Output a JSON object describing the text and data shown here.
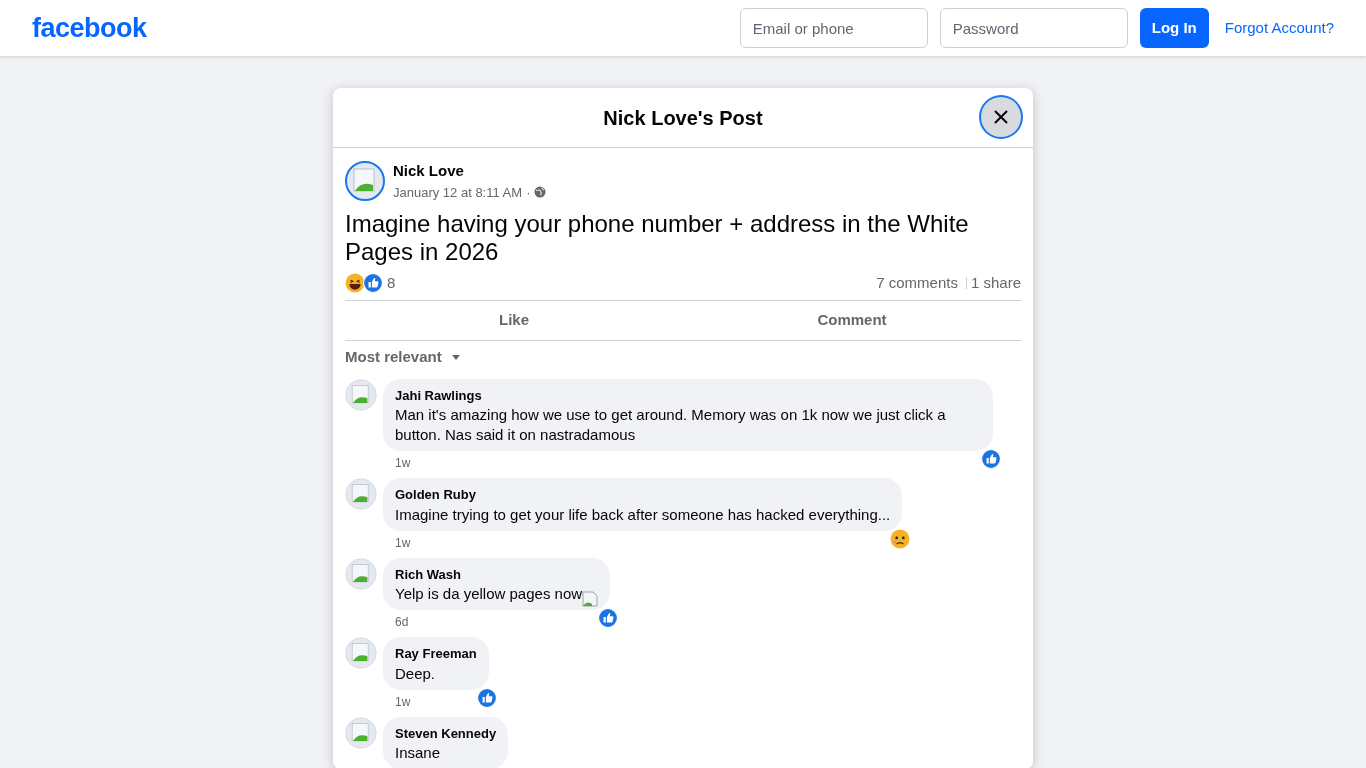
{
  "header": {
    "logo": "facebook",
    "email_field": {
      "placeholder": "Email or phone"
    },
    "password_field": {
      "placeholder": "Password"
    },
    "login_button": "Log In",
    "forgot_link": "Forgot Account?"
  },
  "dialog": {
    "title": "Nick Love's Post",
    "post": {
      "author": "Nick Love",
      "time": "January 12 at 8:11 AM",
      "separator": "·",
      "text": "Imagine having your phone number + address in the White Pages in 2026",
      "reactions": [
        {
          "kind": "haha"
        },
        {
          "kind": "like"
        }
      ],
      "reaction_count": "8",
      "comments_count": "7 comments",
      "shares_count": "1 share"
    },
    "actions": [
      "Like",
      "Comment"
    ],
    "sort": "Most relevant",
    "comments": [
      {
        "author": "Jahi Rawlings",
        "text": "Man it's amazing how we use to get around. Memory was on 1k now we just click a button. Nas said it on nastradamous",
        "time": "1w",
        "reaction": {
          "kind": "like"
        },
        "broken_image": false
      },
      {
        "author": "Golden Ruby",
        "text": "Imagine trying to get your life back after someone has hacked everything...",
        "time": "1w",
        "reaction": {
          "kind": "sad"
        },
        "broken_image": false
      },
      {
        "author": "Rich Wash",
        "text": "Yelp is da yellow pages now",
        "time": "6d",
        "reaction": {
          "kind": "like"
        },
        "broken_image": true
      },
      {
        "author": "Ray Freeman",
        "text": "Deep.",
        "time": "1w",
        "reaction": {
          "kind": "like"
        },
        "broken_image": false
      },
      {
        "author": "Steven Kennedy",
        "text": "Insane",
        "broken_image": false
      }
    ]
  }
}
